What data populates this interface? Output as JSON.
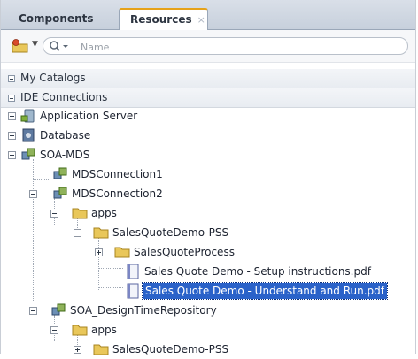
{
  "tabs": {
    "components": "Components",
    "resources": "Resources",
    "close": "×"
  },
  "search": {
    "placeholder": "Name",
    "filter_glyph": "Q▾"
  },
  "sections": {
    "my_catalogs": "My Catalogs",
    "ide_connections": "IDE Connections"
  },
  "tree": {
    "application_server": "Application Server",
    "database": "Database",
    "soa_mds": "SOA-MDS",
    "mds_connection1": "MDSConnection1",
    "mds_connection2": "MDSConnection2",
    "apps": "apps",
    "sales_quote_demo_pss": "SalesQuoteDemo-PSS",
    "sales_quote_process": "SalesQuoteProcess",
    "setup_pdf": "Sales Quote Demo - Setup instructions.pdf",
    "understand_pdf": "Sales Quote Demo - Understand and Run.pdf",
    "soa_design_repo": "SOA_DesignTimeRepository",
    "apps2": "apps",
    "sales_quote_demo_pss2": "SalesQuoteDemo-PSS"
  },
  "colors": {
    "selection": "#2a62c9",
    "folder": "#e9c75a",
    "accent_tab": "#e6a21a"
  }
}
